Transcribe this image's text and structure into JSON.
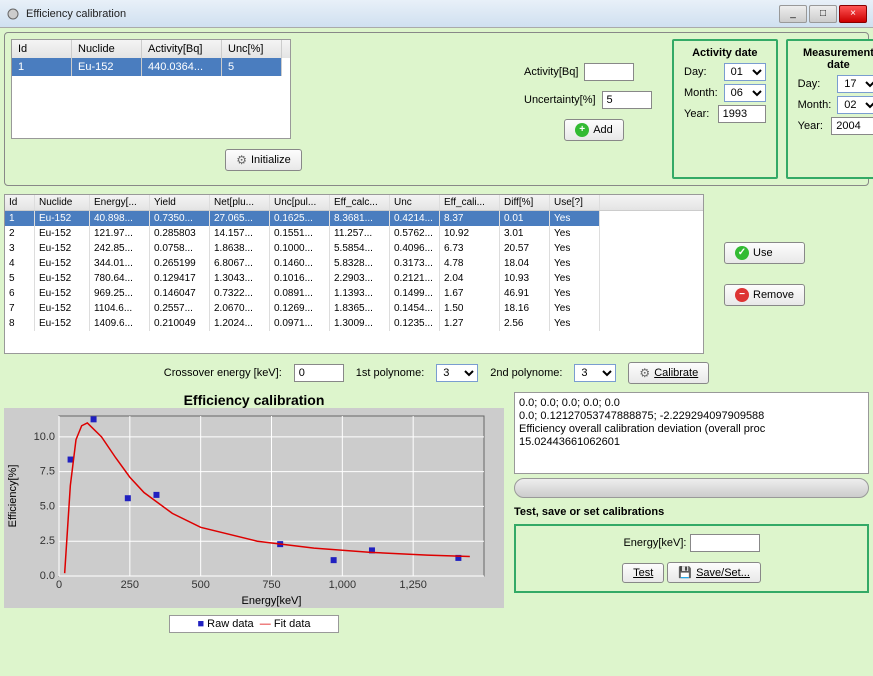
{
  "window": {
    "title": "Efficiency calibration"
  },
  "source_table": {
    "headers": [
      "Id",
      "Nuclide",
      "Activity[Bq]",
      "Unc[%]"
    ],
    "rows": [
      {
        "id": "1",
        "nuclide": "Eu-152",
        "activity": "440.0364...",
        "unc": "5"
      }
    ]
  },
  "initialize_label": "Initialize",
  "activity_label": "Activity[Bq]",
  "activity_value": "",
  "uncertainty_label": "Uncertainty[%]",
  "uncertainty_value": "5",
  "add_label": "Add",
  "activity_date": {
    "title": "Activity date",
    "day_lbl": "Day:",
    "day": "01",
    "month_lbl": "Month:",
    "month": "06",
    "year_lbl": "Year:",
    "year": "1993"
  },
  "measurement_date": {
    "title": "Measurement date",
    "day_lbl": "Day:",
    "day": "17",
    "month_lbl": "Month:",
    "month": "02",
    "year_lbl": "Year:",
    "year": "2004"
  },
  "big_table": {
    "headers": [
      "Id",
      "Nuclide",
      "Energy[...",
      "Yield",
      "Net[plu...",
      "Unc[pul...",
      "Eff_calc...",
      "Unc",
      "Eff_cali...",
      "Diff[%]",
      "Use[?]"
    ],
    "rows": [
      [
        "1",
        "Eu-152",
        "40.898...",
        "0.7350...",
        "27.065...",
        "0.1625...",
        "8.3681...",
        "0.4214...",
        "8.37",
        "0.01",
        "Yes"
      ],
      [
        "2",
        "Eu-152",
        "121.97...",
        "0.285803",
        "14.157...",
        "0.1551...",
        "11.257...",
        "0.5762...",
        "10.92",
        "3.01",
        "Yes"
      ],
      [
        "3",
        "Eu-152",
        "242.85...",
        "0.0758...",
        "1.8638...",
        "0.1000...",
        "5.5854...",
        "0.4096...",
        "6.73",
        "20.57",
        "Yes"
      ],
      [
        "4",
        "Eu-152",
        "344.01...",
        "0.265199",
        "6.8067...",
        "0.1460...",
        "5.8328...",
        "0.3173...",
        "4.78",
        "18.04",
        "Yes"
      ],
      [
        "5",
        "Eu-152",
        "780.64...",
        "0.129417",
        "1.3043...",
        "0.1016...",
        "2.2903...",
        "0.2121...",
        "2.04",
        "10.93",
        "Yes"
      ],
      [
        "6",
        "Eu-152",
        "969.25...",
        "0.146047",
        "0.7322...",
        "0.0891...",
        "1.1393...",
        "0.1499...",
        "1.67",
        "46.91",
        "Yes"
      ],
      [
        "7",
        "Eu-152",
        "1104.6...",
        "0.2557...",
        "2.0670...",
        "0.1269...",
        "1.8365...",
        "0.1454...",
        "1.50",
        "18.16",
        "Yes"
      ],
      [
        "8",
        "Eu-152",
        "1409.6...",
        "0.210049",
        "1.2024...",
        "0.0971...",
        "1.3009...",
        "0.1235...",
        "1.27",
        "2.56",
        "Yes"
      ]
    ]
  },
  "use_label": "Use",
  "remove_label": "Remove",
  "crossover_label": "Crossover energy [keV]:",
  "crossover_value": "0",
  "poly1_label": "1st polynome:",
  "poly1_value": "3",
  "poly2_label": "2nd polynome:",
  "poly2_value": "3",
  "calibrate_label": "Calibrate",
  "chart_data": {
    "type": "scatter+line",
    "title": "Efficiency calibration",
    "xlabel": "Energy[keV]",
    "ylabel": "Efficiency[%]",
    "xlim": [
      0,
      1500
    ],
    "ylim": [
      0,
      11.5
    ],
    "xticks": [
      0,
      250,
      500,
      750,
      1000,
      1250
    ],
    "yticks": [
      0.0,
      2.5,
      5.0,
      7.5,
      10.0
    ],
    "series": [
      {
        "name": "Raw data",
        "type": "scatter",
        "color": "#2020c0",
        "marker": "square",
        "x": [
          40.9,
          122.0,
          242.9,
          344.0,
          780.6,
          969.3,
          1104.6,
          1409.6
        ],
        "y": [
          8.37,
          11.26,
          5.59,
          5.83,
          2.29,
          1.14,
          1.84,
          1.3
        ]
      },
      {
        "name": "Fit data",
        "type": "line",
        "color": "#d00",
        "x": [
          20,
          40,
          60,
          80,
          100,
          150,
          200,
          250,
          300,
          400,
          500,
          700,
          900,
          1100,
          1300,
          1450
        ],
        "y": [
          0.2,
          6.5,
          9.8,
          10.8,
          11.0,
          10.0,
          8.5,
          7.1,
          6.0,
          4.5,
          3.5,
          2.5,
          2.0,
          1.7,
          1.5,
          1.4
        ]
      }
    ],
    "legend": [
      "Raw data",
      "Fit data"
    ]
  },
  "log_lines": [
    "0.0; 0.0; 0.0; 0.0; 0.0",
    "0.0; 0.12127053747888875; -2.229294097909588",
    "Efficiency overall calibration deviation (overall proc",
    "15.02443661062601"
  ],
  "test_panel": {
    "title": "Test, save or set calibrations",
    "energy_lbl": "Energy[keV]:",
    "energy_val": "",
    "test_btn": "Test",
    "save_btn": "Save/Set..."
  }
}
